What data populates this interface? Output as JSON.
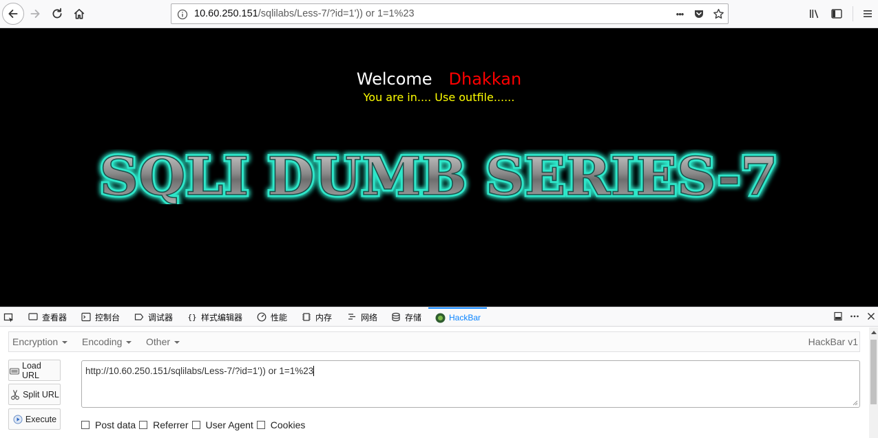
{
  "browser": {
    "url_host": "10.60.250.151",
    "url_path": "/sqlilabs/Less-7/?id=1')) or 1=1%23",
    "more_label": "•••"
  },
  "page": {
    "welcome": "Welcome",
    "name": "Dhakkan",
    "status": "You are in.... Use outfile......",
    "banner": "SQLI DUMB SERIES-7"
  },
  "devtools": {
    "tabs": [
      {
        "label": "查看器",
        "icon": "inspector-icon"
      },
      {
        "label": "控制台",
        "icon": "console-icon"
      },
      {
        "label": "调试器",
        "icon": "debugger-icon"
      },
      {
        "label": "样式编辑器",
        "icon": "style-editor-icon"
      },
      {
        "label": "性能",
        "icon": "performance-icon"
      },
      {
        "label": "内存",
        "icon": "memory-icon"
      },
      {
        "label": "网络",
        "icon": "network-icon"
      },
      {
        "label": "存储",
        "icon": "storage-icon"
      },
      {
        "label": "HackBar",
        "icon": "hackbar-icon"
      }
    ],
    "active_tab": "HackBar"
  },
  "hackbar": {
    "menu": [
      "Encryption",
      "Encoding",
      "Other"
    ],
    "version": "HackBar v1",
    "buttons": {
      "load": "Load URL",
      "split": "Split URL",
      "execute": "Execute"
    },
    "url_value": "http://10.60.250.151/sqlilabs/Less-7/?id=1')) or 1=1%23",
    "options": [
      "Post data",
      "Referrer",
      "User Agent",
      "Cookies"
    ]
  },
  "colors": {
    "page_bg": "#000000",
    "welcome": "#ffffff",
    "name": "#ff0000",
    "status": "#ffff00",
    "banner_glow": "#2ee6c9",
    "active_tab": "#0a84ff"
  }
}
